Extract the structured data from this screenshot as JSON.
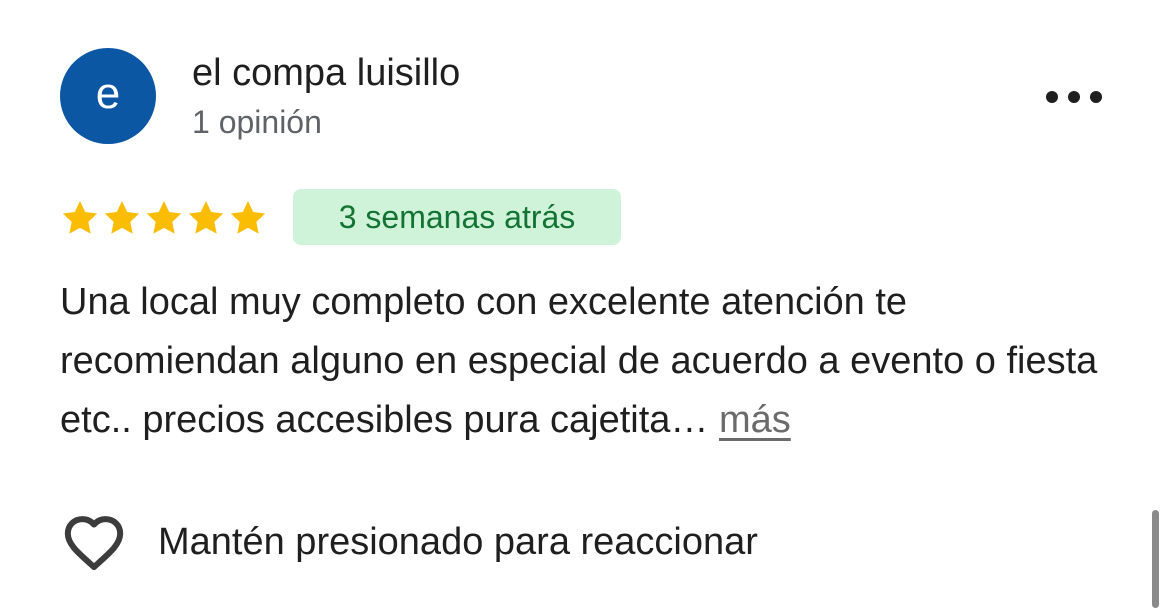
{
  "reviewer": {
    "initial": "e",
    "name": "el compa luisillo",
    "review_count": "1 opinión",
    "avatar_color": "#0b57a4"
  },
  "menu": {
    "icon": "more-horizontal-icon"
  },
  "rating": {
    "stars": 5,
    "max": 5,
    "star_color": "#fbbc04"
  },
  "time_badge": {
    "label": "3 semanas atrás",
    "bg_color": "#cff3d9",
    "text_color": "#137333"
  },
  "review": {
    "text": "Una local muy completo con excelente atención te recomiendan alguno en especial de acuerdo a evento o fiesta etc.. precios accesibles pura cajetita…",
    "more_label": "más"
  },
  "reaction": {
    "icon": "heart-outline-icon",
    "label": "Mantén presionado para reaccionar"
  }
}
